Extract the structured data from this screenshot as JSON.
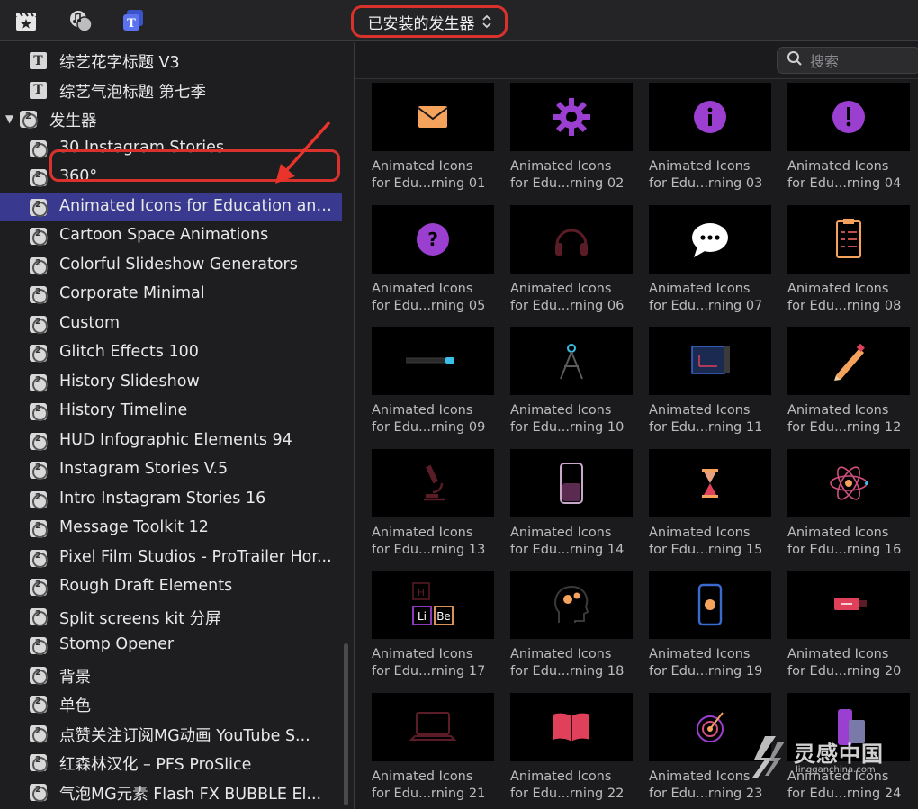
{
  "toolbar": {
    "icons": [
      "clapper-star-icon",
      "music-photo-icon",
      "titles-generators-icon"
    ],
    "popup_label": "已安装的发生器"
  },
  "sidebar": {
    "items": [
      {
        "label": "综艺花字标题 V3",
        "kind": "title"
      },
      {
        "label": "综艺气泡标题 第七季",
        "kind": "title"
      },
      {
        "label": "发生器",
        "kind": "parent"
      },
      {
        "label": "30 Instagram Stories",
        "kind": "generator"
      },
      {
        "label": "360°",
        "kind": "generator"
      },
      {
        "label": "Animated Icons for Education and...",
        "kind": "generator",
        "selected": true
      },
      {
        "label": "Cartoon Space Animations",
        "kind": "generator"
      },
      {
        "label": "Colorful Slideshow Generators",
        "kind": "generator"
      },
      {
        "label": "Corporate Minimal",
        "kind": "generator"
      },
      {
        "label": "Custom",
        "kind": "generator"
      },
      {
        "label": "Glitch Effects 100",
        "kind": "generator"
      },
      {
        "label": "History Slideshow",
        "kind": "generator"
      },
      {
        "label": "History Timeline",
        "kind": "generator"
      },
      {
        "label": "HUD Infographic Elements 94",
        "kind": "generator"
      },
      {
        "label": "Instagram Stories V.5",
        "kind": "generator"
      },
      {
        "label": "Intro Instagram Stories 16",
        "kind": "generator"
      },
      {
        "label": "Message Toolkit 12",
        "kind": "generator"
      },
      {
        "label": "Pixel Film Studios - ProTrailer Hor...",
        "kind": "generator"
      },
      {
        "label": "Rough Draft Elements",
        "kind": "generator"
      },
      {
        "label": "Split screens kit 分屏",
        "kind": "generator"
      },
      {
        "label": "Stomp Opener",
        "kind": "generator"
      },
      {
        "label": "背景",
        "kind": "generator"
      },
      {
        "label": "单色",
        "kind": "generator"
      },
      {
        "label": "点赞关注订阅MG动画 YouTube S...",
        "kind": "generator"
      },
      {
        "label": "红森林汉化 – PFS ProSlice",
        "kind": "generator"
      },
      {
        "label": "气泡MG元素 Flash FX BUBBLE El...",
        "kind": "generator"
      }
    ],
    "generator_icon_glyph": "2",
    "title_icon_glyph": "T"
  },
  "search": {
    "placeholder": "搜索"
  },
  "tiles": [
    {
      "line1": "Animated Icons",
      "line2": "for Edu...rning 01",
      "icon": "envelope-icon"
    },
    {
      "line1": "Animated Icons",
      "line2": "for Edu...rning 02",
      "icon": "gear-icon"
    },
    {
      "line1": "Animated Icons",
      "line2": "for Edu...rning 03",
      "icon": "info-icon"
    },
    {
      "line1": "Animated Icons",
      "line2": "for Edu...rning 04",
      "icon": "exclamation-icon"
    },
    {
      "line1": "Animated Icons",
      "line2": "for Edu...rning 05",
      "icon": "question-icon"
    },
    {
      "line1": "Animated Icons",
      "line2": "for Edu...rning 06",
      "icon": "headphones-icon"
    },
    {
      "line1": "Animated Icons",
      "line2": "for Edu...rning 07",
      "icon": "chat-bubble-icon"
    },
    {
      "line1": "Animated Icons",
      "line2": "for Edu...rning 08",
      "icon": "clipboard-icon"
    },
    {
      "line1": "Animated Icons",
      "line2": "for Edu...rning 09",
      "icon": "marker-pen-icon"
    },
    {
      "line1": "Animated Icons",
      "line2": "for Edu...rning 10",
      "icon": "compass-icon"
    },
    {
      "line1": "Animated Icons",
      "line2": "for Edu...rning 11",
      "icon": "blueprint-icon"
    },
    {
      "line1": "Animated Icons",
      "line2": "for Edu...rning 12",
      "icon": "pencil-icon"
    },
    {
      "line1": "Animated Icons",
      "line2": "for Edu...rning 13",
      "icon": "microscope-icon"
    },
    {
      "line1": "Animated Icons",
      "line2": "for Edu...rning 14",
      "icon": "beaker-icon"
    },
    {
      "line1": "Animated Icons",
      "line2": "for Edu...rning 15",
      "icon": "hourglass-icon"
    },
    {
      "line1": "Animated Icons",
      "line2": "for Edu...rning 16",
      "icon": "atom-icon"
    },
    {
      "line1": "Animated Icons",
      "line2": "for Edu...rning 17",
      "icon": "periodic-elements-icon",
      "elements": [
        "H",
        "Li",
        "Be"
      ]
    },
    {
      "line1": "Animated Icons",
      "line2": "for Edu...rning 18",
      "icon": "head-gears-icon"
    },
    {
      "line1": "Animated Icons",
      "line2": "for Edu...rning 19",
      "icon": "phone-icon"
    },
    {
      "line1": "Animated Icons",
      "line2": "for Edu...rning 20",
      "icon": "usb-drive-icon"
    },
    {
      "line1": "Animated Icons",
      "line2": "for Edu...rning 21",
      "icon": "laptop-icon"
    },
    {
      "line1": "Animated Icons",
      "line2": "for Edu...rning 22",
      "icon": "open-book-icon"
    },
    {
      "line1": "Animated Icons",
      "line2": "for Edu...rning 23",
      "icon": "target-icon"
    },
    {
      "line1": "Animated Icons",
      "line2": "for Edu...rning 24",
      "icon": "desk-phone-icon"
    }
  ],
  "watermark": {
    "line1": "灵感中国",
    "line2": "lingganchina.com"
  },
  "colors": {
    "accent_red": "#d9322c",
    "selection": "#39398f",
    "purple": "#9b3fd0",
    "orange": "#f5a25d",
    "pink_red": "#e0405a"
  }
}
